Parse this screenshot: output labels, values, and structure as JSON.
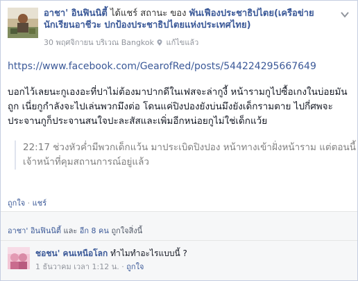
{
  "post": {
    "author": "อาชา' อินฟินนิตี้",
    "shared_text": "ได้แชร์ สถานะ ของ",
    "page_name": "พันเฟืองประชาธิปไตย(เครือข่ายนักเรียนอาชีวะ ปกป้องประชาธิปไตยแห่งประเทศไทย)",
    "date": "30 พฤศจิกายน",
    "location_prefix": "บริเวณ",
    "location": "Bangkok",
    "edited": "แก้ไขแล้ว",
    "url": "https://www.facebook.com/GearofRed/posts/544224295667649",
    "text": "บอกไว้เลยนะกูเองอะที่ปาไม่ต้องมาปากดีในเฟสจะล่ากูงี้ หน้ารามกูไปซื้อเกงในบ่อยมันถูก เนี่ยกูกำลังจะไปเล่นพวกมึงต่อ โดนแค่ปิงปองยังบ่นมึงยังเด็กรามตาย ไปกี่ศพจะประจานกูก็ประจานสนใจปะละสัสและเพิ่มอีกหน่อยกูไม่ใช่เด็กแว้ย",
    "quote": "22:17 ช่วงหัวค่ำมีพวกเด็กแว้น มาประเบิดปิงปอง หน้าทางเข้าฝั่งหน้าราม แต่ตอนนี้ เจ้าหน้าที่คุมสถานการณ์อยู่แล้ว"
  },
  "actions": {
    "like": "ถูกใจ",
    "sep": "·",
    "share": "แชร์"
  },
  "likes": {
    "name": "อาชา' อินฟินนิตี้",
    "and": "และ",
    "others": "อีก 8 คน",
    "suffix": "ถูกใจสิ่งนี้"
  },
  "comment": {
    "name": "ชอชน' คนเหนือโลก",
    "text": "ทำไมทำอะไรแบบนี้ ?",
    "time": "1 ธันวาคม เวลา 1:12 น.",
    "like": "ถูกใจ"
  },
  "icons": {
    "menu": "chevron-down-icon",
    "location": "location-pin-icon"
  },
  "colors": {
    "link": "#3b5998",
    "muted": "#90949c",
    "text": "#141823",
    "panel": "#f6f7f8"
  }
}
